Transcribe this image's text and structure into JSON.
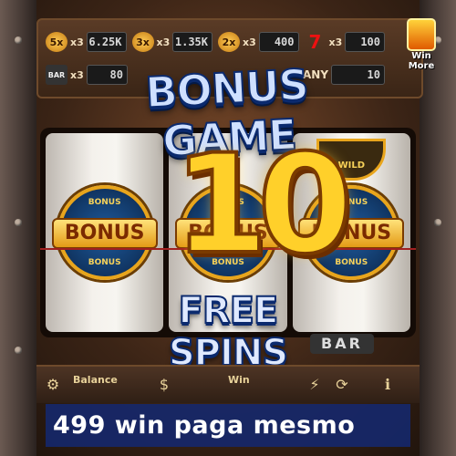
{
  "paytable": {
    "row1": [
      {
        "symbol": "5x",
        "multiplier": "x3",
        "value": "6.25K"
      },
      {
        "symbol": "3x",
        "multiplier": "x3",
        "value": "1.35K"
      },
      {
        "symbol": "2x",
        "multiplier": "x3",
        "value": "400"
      },
      {
        "symbol": "7",
        "multiplier": "x3",
        "value": "100"
      }
    ],
    "row2": [
      {
        "symbol": "BAR",
        "multiplier": "x3",
        "value": "80"
      },
      {
        "symbol": "ANY",
        "value": "10"
      }
    ]
  },
  "win_more": {
    "label": "Win More"
  },
  "title": "BONUS GAME",
  "big_number": "10",
  "subtitle": "FREE SPINS",
  "reels": [
    {
      "symbol_top": "",
      "symbol": "BONUS",
      "arc_top": "BONUS",
      "arc_bottom": "BONUS"
    },
    {
      "symbol_top": "",
      "symbol": "BONUS",
      "arc_top": "BONUS",
      "arc_bottom": "BONUS"
    },
    {
      "symbol_top": "WILD",
      "symbol": "BONUS",
      "arc_top": "BONUS",
      "arc_bottom": "BONUS"
    }
  ],
  "bar_symbol": "BAR",
  "controls": {
    "balance_label": "Balance",
    "win_label": "Win"
  },
  "caption": "499 win paga mesmo",
  "colors": {
    "caption_bg": "#142870",
    "gold": "#ffd02a",
    "title_blue": "#cfe0ff"
  }
}
